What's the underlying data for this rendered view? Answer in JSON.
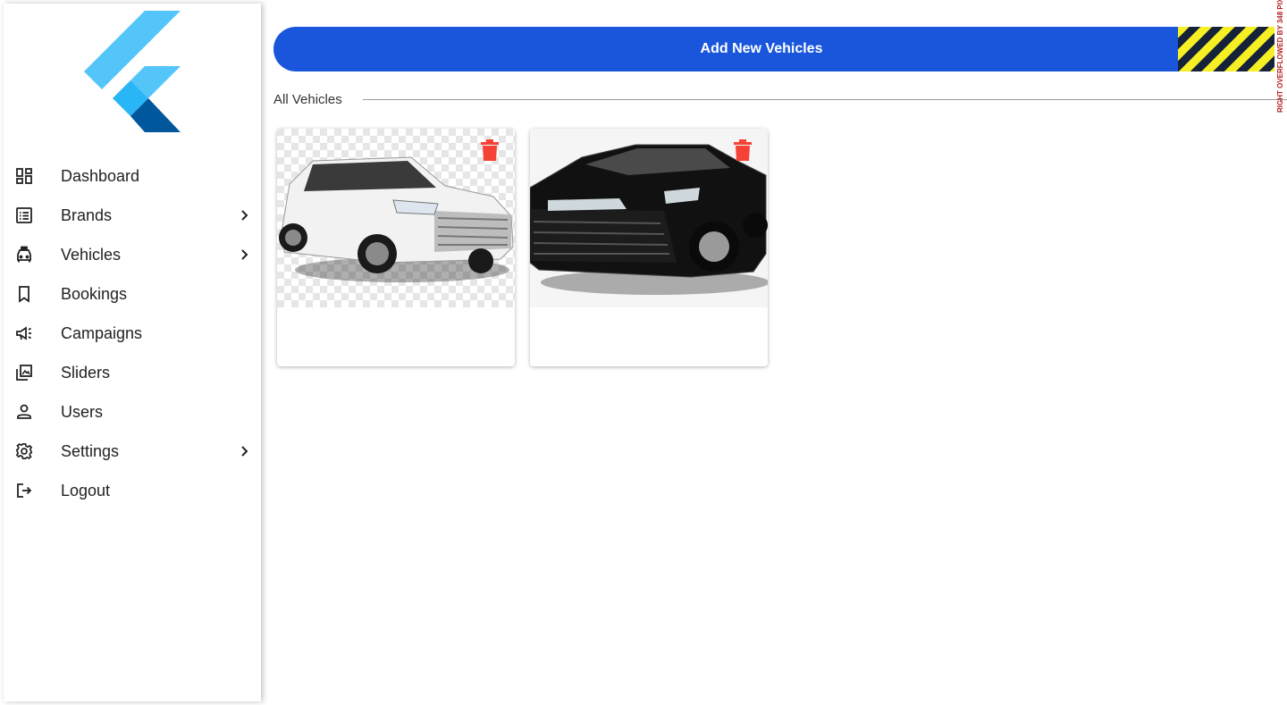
{
  "sidebar": {
    "logo": "flutter-logo",
    "items": [
      {
        "label": "Dashboard",
        "icon": "dashboard-icon",
        "has_children": false
      },
      {
        "label": "Brands",
        "icon": "list-icon",
        "has_children": true
      },
      {
        "label": "Vehicles",
        "icon": "taxi-icon",
        "has_children": true
      },
      {
        "label": "Bookings",
        "icon": "bookmark-icon",
        "has_children": false
      },
      {
        "label": "Campaigns",
        "icon": "campaign-icon",
        "has_children": false
      },
      {
        "label": "Sliders",
        "icon": "photo-library-icon",
        "has_children": false
      },
      {
        "label": "Users",
        "icon": "person-icon",
        "has_children": false
      },
      {
        "label": "Settings",
        "icon": "gear-icon",
        "has_children": true
      },
      {
        "label": "Logout",
        "icon": "logout-icon",
        "has_children": false
      }
    ]
  },
  "main": {
    "add_button_label": "Add New Vehicles",
    "overflow_warning": "RIGHT OVERFLOWED BY 348 PIX",
    "section_title": "All Vehicles",
    "vehicles": [
      {
        "name": "white-suv",
        "color": "#f2f2f2",
        "delete_icon": "trash-icon"
      },
      {
        "name": "black-sedan",
        "color": "#111111",
        "delete_icon": "trash-icon"
      }
    ]
  },
  "colors": {
    "primary": "#1a56db",
    "delete": "#f44336",
    "flutter_light": "#54c5f8",
    "flutter_mid": "#29b6f6",
    "flutter_dark": "#01579b"
  }
}
